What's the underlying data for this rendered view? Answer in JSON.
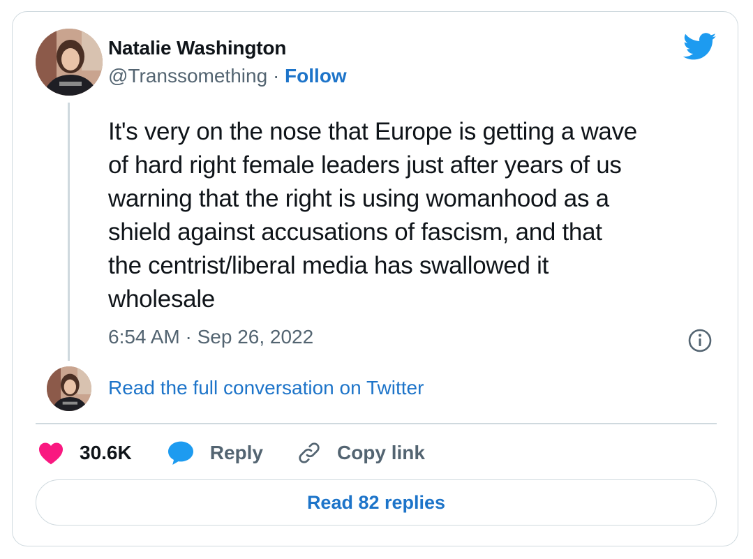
{
  "author": {
    "name": "Natalie Washington",
    "handle": "@Transsomething",
    "separator": "·",
    "follow_label": "Follow"
  },
  "tweet": {
    "text": "It's very on the nose that Europe is getting a wave\nof hard right female leaders just after years of us\nwarning that the right is using womanhood as a\nshield against accusations of fascism, and that\nthe centrist/liberal media has swallowed it\nwholesale",
    "timestamp": "6:54 AM · Sep 26, 2022"
  },
  "conversation_link": "Read the full conversation on Twitter",
  "actions": {
    "like_count": "30.6K",
    "reply_label": "Reply",
    "copy_link_label": "Copy link"
  },
  "replies_button": "Read 82 replies",
  "colors": {
    "link": "#1d74c9",
    "twitter_blue": "#1d9bf0",
    "heart": "#f91880",
    "muted": "#536471",
    "border": "#cfd9de"
  },
  "icons": [
    "twitter-bird-icon",
    "info-icon",
    "heart-icon",
    "reply-bubble-icon",
    "link-icon"
  ]
}
